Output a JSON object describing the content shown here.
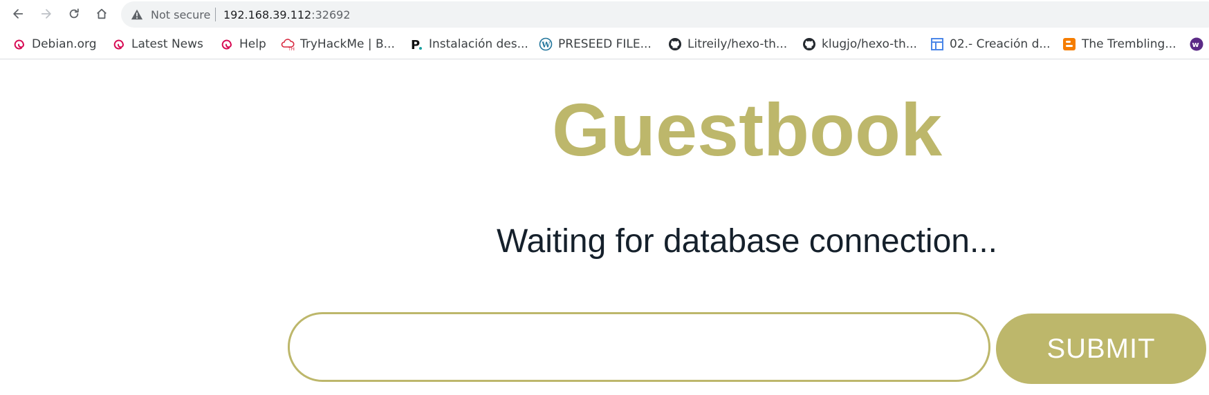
{
  "browser": {
    "nav": {
      "back_icon": "arrow-left-icon",
      "forward_icon": "arrow-right-icon",
      "reload_icon": "reload-icon",
      "home_icon": "home-icon"
    },
    "omnibox": {
      "security_icon": "warning-triangle-icon",
      "security_text": "Not secure",
      "url_host": "192.168.39.112",
      "url_port": ":32692"
    },
    "bookmarks": [
      {
        "label": "Debian.org",
        "icon": "debian-swirl-icon",
        "color": "#d70a53"
      },
      {
        "label": "Latest News",
        "icon": "debian-swirl-icon",
        "color": "#d70a53"
      },
      {
        "label": "Help",
        "icon": "debian-swirl-icon",
        "color": "#d70a53"
      },
      {
        "label": "TryHackMe | B...",
        "icon": "cloud-icon",
        "color": "#d7263d"
      },
      {
        "label": "Instalación des...",
        "icon": "p-letter-icon",
        "color": "#111111"
      },
      {
        "label": "PRESEED FILE...",
        "icon": "wordpress-icon",
        "color": "#21759b"
      },
      {
        "label": "Litreily/hexo-th...",
        "icon": "github-icon",
        "color": "#24292f"
      },
      {
        "label": "klugjo/hexo-th...",
        "icon": "github-icon",
        "color": "#24292f"
      },
      {
        "label": "02.- Creación d...",
        "icon": "layout-icon",
        "color": "#4a86e8"
      },
      {
        "label": "The Trembling...",
        "icon": "blogger-icon",
        "color": "#f57d00"
      },
      {
        "label": "",
        "icon": "w-circle-icon",
        "color": "#5b2a86"
      }
    ]
  },
  "page": {
    "title": "Guestbook",
    "status": "Waiting for database connection...",
    "entry": {
      "value": "",
      "placeholder": ""
    },
    "submit_label": "SUBMIT",
    "accent_color": "#bdb76b",
    "text_color": "#15202b"
  }
}
